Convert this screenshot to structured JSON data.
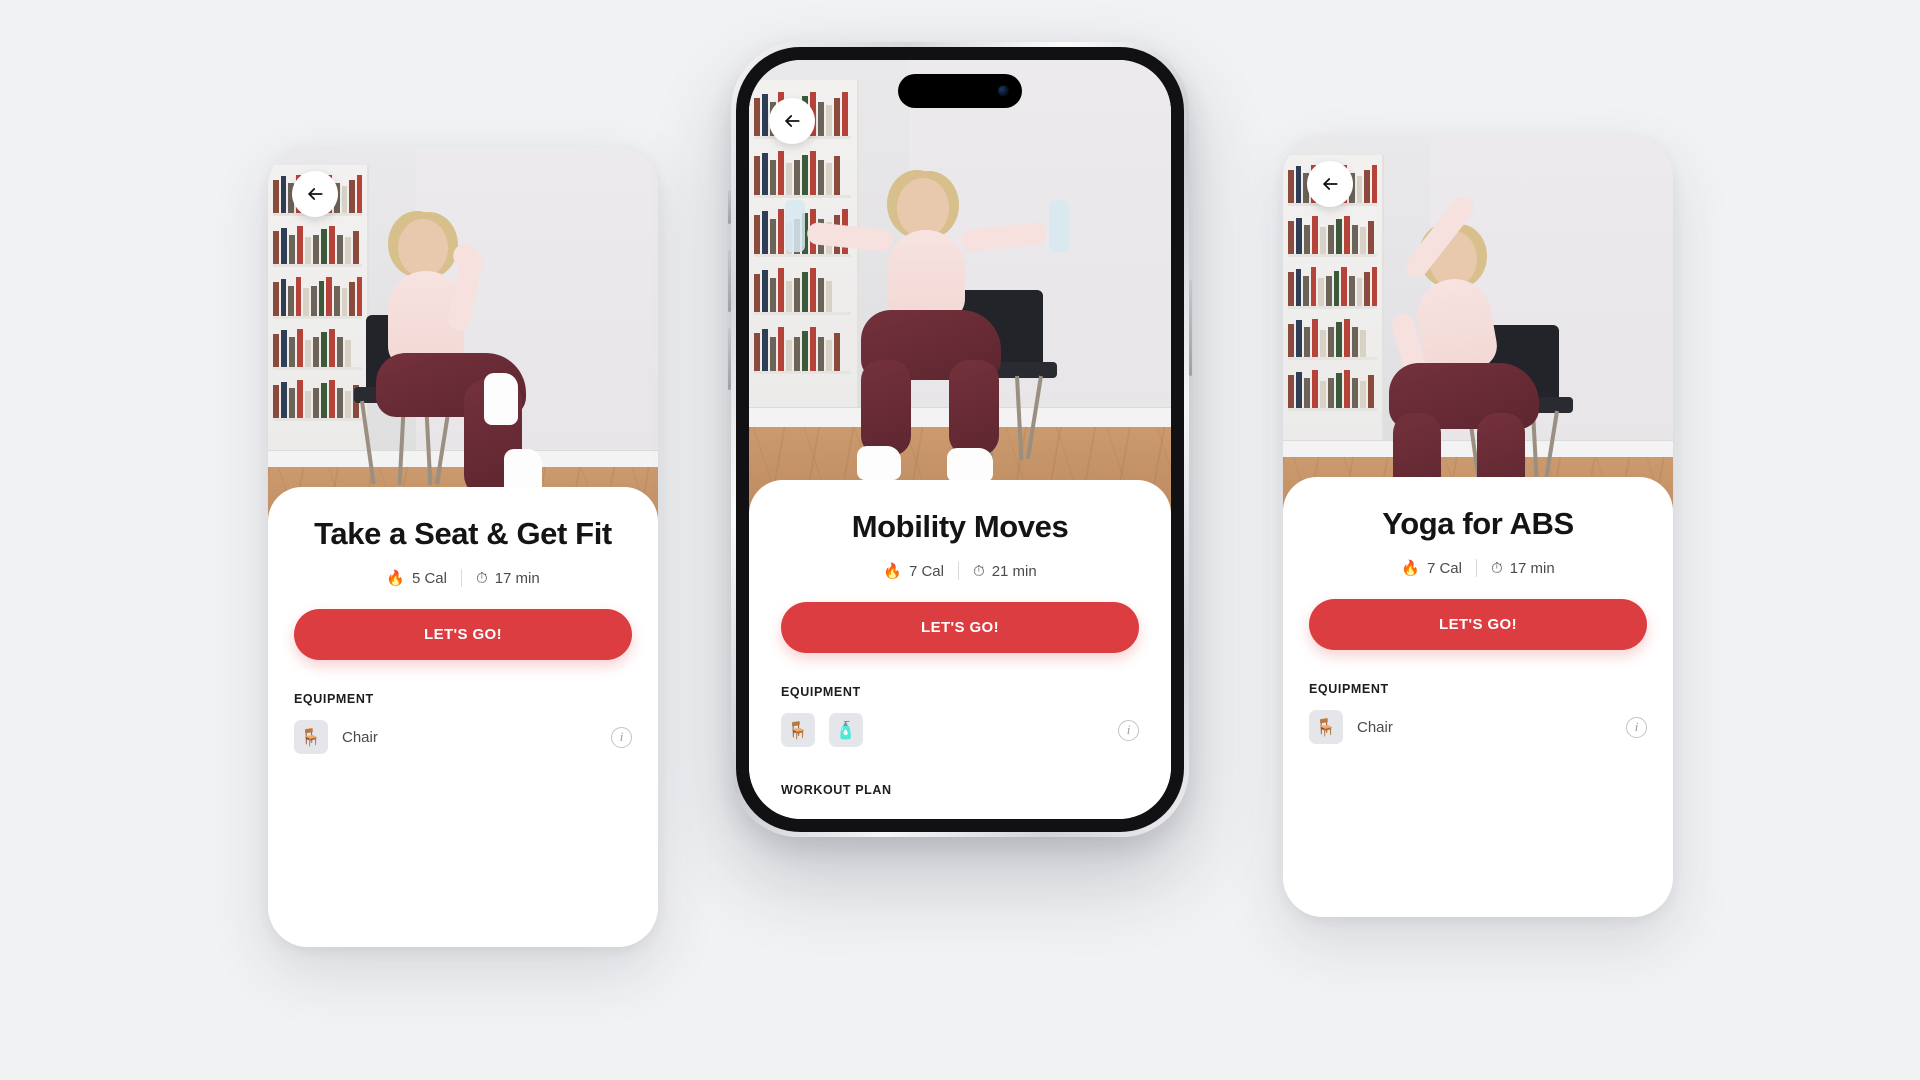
{
  "theme": {
    "background": "#f1f2f4",
    "accent": "#dc3d41",
    "card_background": "#ffffff",
    "title_color": "#141414",
    "meta_color": "#4c4c4c"
  },
  "icons": {
    "back_arrow": "arrow-left",
    "calories": "🔥",
    "duration": "⏱",
    "chair": "🪑",
    "water_bottle": "🧴",
    "info": "i"
  },
  "screens": [
    {
      "id": "take-a-seat",
      "back_label": "Back",
      "title": "Take a Seat & Get Fit",
      "calories": "5 Cal",
      "duration": "17 min",
      "cta_label": "LET'S GO!",
      "equipment_label": "EQUIPMENT",
      "equipment": [
        {
          "name": "Chair",
          "icon": "🪑"
        }
      ],
      "info_label": "i"
    },
    {
      "id": "mobility-moves",
      "back_label": "Back",
      "title": "Mobility Moves",
      "calories": "7 Cal",
      "duration": "21 min",
      "cta_label": "LET'S GO!",
      "equipment_label": "EQUIPMENT",
      "equipment": [
        {
          "name": "Chair",
          "icon": "🪑"
        },
        {
          "name": "Water Bottle",
          "icon": "🧴"
        }
      ],
      "workout_plan_label": "WORKOUT PLAN",
      "info_label": "i"
    },
    {
      "id": "yoga-for-abs",
      "back_label": "Back",
      "title": "Yoga for ABS",
      "calories": "7 Cal",
      "duration": "17 min",
      "cta_label": "LET'S GO!",
      "equipment_label": "EQUIPMENT",
      "equipment": [
        {
          "name": "Chair",
          "icon": "🪑"
        }
      ],
      "info_label": "i"
    }
  ]
}
